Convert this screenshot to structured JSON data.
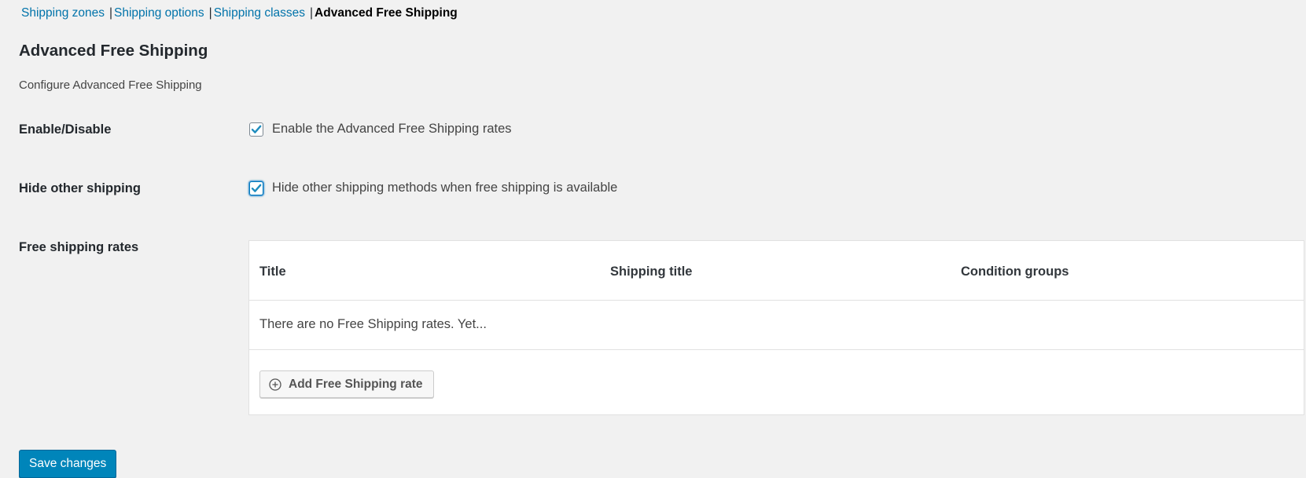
{
  "nav": {
    "links": [
      "Shipping zones",
      "Shipping options",
      "Shipping classes"
    ],
    "current": "Advanced Free Shipping",
    "separator": "|"
  },
  "header": {
    "title": "Advanced Free Shipping",
    "description": "Configure Advanced Free Shipping"
  },
  "settings": {
    "enable": {
      "label": "Enable/Disable",
      "checkbox_label": "Enable the Advanced Free Shipping rates",
      "checked": true
    },
    "hide_other": {
      "label": "Hide other shipping",
      "checkbox_label": "Hide other shipping methods when free shipping is available",
      "checked": true
    },
    "rates": {
      "label": "Free shipping rates",
      "columns": [
        "Title",
        "Shipping title",
        "Condition groups"
      ],
      "empty_message": "There are no Free Shipping rates. Yet...",
      "add_button_label": "Add Free Shipping rate"
    }
  },
  "footer": {
    "save_label": "Save changes"
  },
  "colors": {
    "link": "#0073aa",
    "primary_button": "#0085ba",
    "checkmark": "#1e8cbe",
    "background": "#f1f1f1"
  },
  "icons": {
    "checkbox_check": "checkmark-icon",
    "add_button": "plus-circle-icon"
  }
}
